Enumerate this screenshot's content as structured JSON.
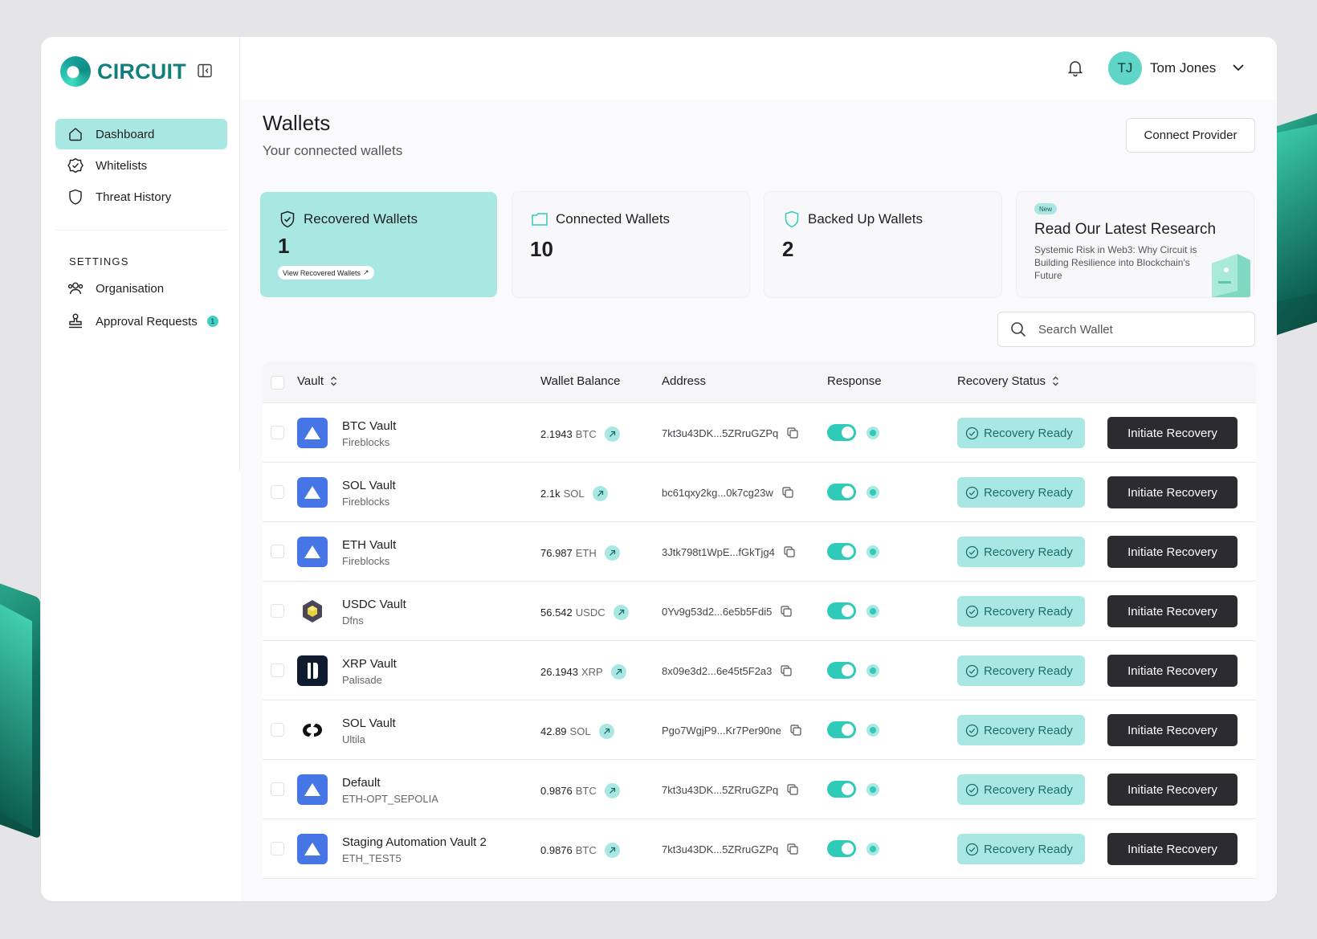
{
  "brand": {
    "name": "CIRCUIT",
    "color": "#117f7a"
  },
  "sidebar": {
    "items": [
      {
        "label": "Dashboard",
        "icon": "home-icon",
        "active": true
      },
      {
        "label": "Whitelists",
        "icon": "verified-badge-icon",
        "active": false
      },
      {
        "label": "Threat History",
        "icon": "shield-icon",
        "active": false
      }
    ],
    "settings_label": "SETTINGS",
    "settings_items": [
      {
        "label": "Organisation",
        "icon": "users-icon"
      },
      {
        "label": "Approval Requests",
        "icon": "stamp-icon",
        "badge": "1"
      }
    ]
  },
  "header": {
    "user_initials": "TJ",
    "user_name": "Tom Jones"
  },
  "page": {
    "title": "Wallets",
    "subtitle": "Your connected wallets",
    "connect_button": "Connect Provider"
  },
  "cards": {
    "recovered": {
      "title": "Recovered Wallets",
      "value": "1",
      "link": "View Recovered Wallets"
    },
    "connected": {
      "title": "Connected Wallets",
      "value": "10"
    },
    "backed_up": {
      "title": "Backed Up Wallets",
      "value": "2"
    },
    "research": {
      "badge": "New",
      "title": "Read Our Latest Research",
      "description": "Systemic Risk in Web3: Why Circuit is Building Resilience into Blockchain's Future"
    }
  },
  "search": {
    "placeholder": "Search Wallet"
  },
  "table": {
    "headers": {
      "vault": "Vault",
      "balance": "Wallet Balance",
      "address": "Address",
      "response": "Response",
      "status": "Recovery Status"
    },
    "rows": [
      {
        "name": "BTC Vault",
        "provider": "Fireblocks",
        "amount": "2.1943",
        "unit": "BTC",
        "address": "7kt3u43DK...5ZRruGZPq",
        "status": "Recovery Ready",
        "action": "Initiate Recovery",
        "icon": "fireblocks-logo-icon"
      },
      {
        "name": "SOL Vault",
        "provider": "Fireblocks",
        "amount": "2.1k",
        "unit": "SOL",
        "address": "bc61qxy2kg...0k7cg23w",
        "status": "Recovery Ready",
        "action": "Initiate Recovery",
        "icon": "fireblocks-logo-icon"
      },
      {
        "name": "ETH Vault",
        "provider": "Fireblocks",
        "amount": "76.987",
        "unit": "ETH",
        "address": "3Jtk798t1WpE...fGkTjg4",
        "status": "Recovery Ready",
        "action": "Initiate Recovery",
        "icon": "fireblocks-logo-icon"
      },
      {
        "name": "USDC Vault",
        "provider": "Dfns",
        "amount": "56.542",
        "unit": "USDC",
        "address": "0Yv9g53d2...6e5b5Fdi5",
        "status": "Recovery Ready",
        "action": "Initiate Recovery",
        "icon": "dfns-logo-icon"
      },
      {
        "name": "XRP Vault",
        "provider": "Palisade",
        "amount": "26.1943",
        "unit": "XRP",
        "address": "8x09e3d2...6e45t5F2a3",
        "status": "Recovery Ready",
        "action": "Initiate Recovery",
        "icon": "palisade-logo-icon"
      },
      {
        "name": "SOL Vault",
        "provider": "Ultila",
        "amount": "42.89",
        "unit": "SOL",
        "address": "Pgo7WgjP9...Kr7Per90ne",
        "status": "Recovery Ready",
        "action": "Initiate Recovery",
        "icon": "ultila-logo-icon"
      },
      {
        "name": "Default",
        "provider": "ETH-OPT_SEPOLIA",
        "amount": "0.9876",
        "unit": "BTC",
        "address": "7kt3u43DK...5ZRruGZPq",
        "status": "Recovery Ready",
        "action": "Initiate Recovery",
        "icon": "fireblocks-logo-icon"
      },
      {
        "name": "Staging Automation Vault 2",
        "provider": "ETH_TEST5",
        "amount": "0.9876",
        "unit": "BTC",
        "address": "7kt3u43DK...5ZRruGZPq",
        "status": "Recovery Ready",
        "action": "Initiate Recovery",
        "icon": "fireblocks-logo-icon"
      }
    ]
  },
  "colors": {
    "accent": "#a9e8e2",
    "toggle": "#2fcab8",
    "dark_button": "#2c2c30"
  }
}
